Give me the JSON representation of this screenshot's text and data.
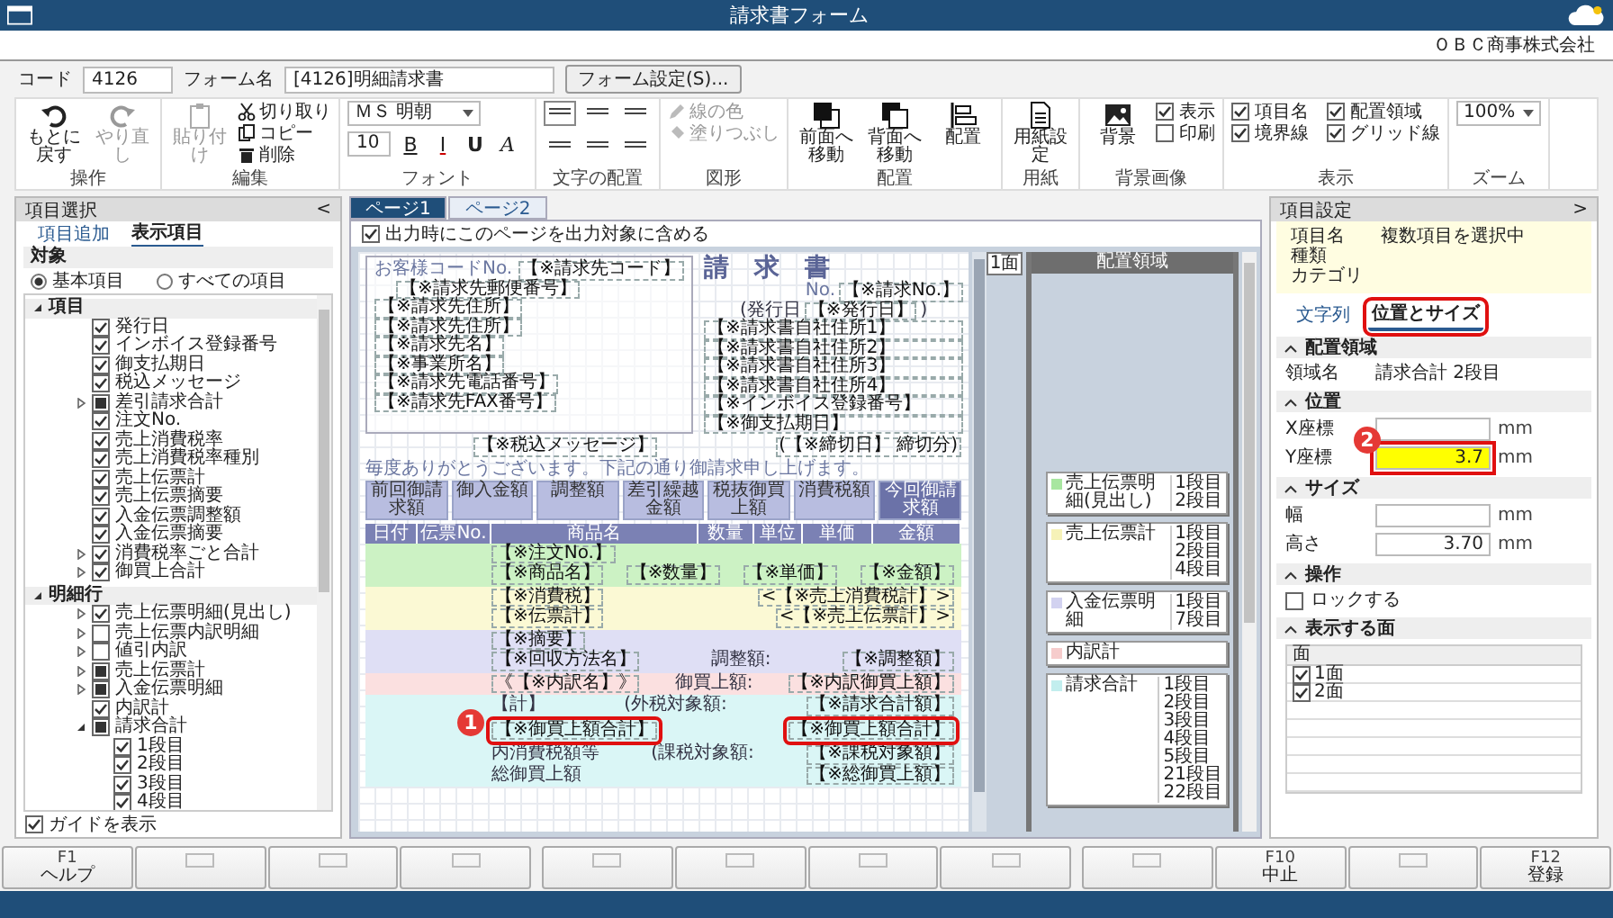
{
  "window": {
    "title": "請求書フォーム",
    "company": "ＯＢＣ商事株式会社"
  },
  "form_header": {
    "code_label": "コード",
    "code": "4126",
    "name_label": "フォーム名",
    "name": "[4126]明細請求書",
    "settings_button": "フォーム設定(S)..."
  },
  "ribbon": [
    {
      "name": "操作",
      "tools": [
        {
          "kind": "undo",
          "label": "もとに戻す",
          "disabled": false
        },
        {
          "kind": "redo",
          "label": "やり直し",
          "disabled": true
        }
      ]
    },
    {
      "name": "編集",
      "tools": [
        {
          "kind": "paste",
          "label": "貼り付け",
          "disabled": true
        },
        {
          "kind": "cut",
          "label": "切り取り",
          "disabled": false
        },
        {
          "kind": "copy",
          "label": "コピー",
          "disabled": false
        },
        {
          "kind": "delete",
          "label": "削除",
          "disabled": false
        }
      ]
    },
    {
      "name": "フォント",
      "tools": [
        {
          "kind": "select",
          "value": "ＭＳ 明朝"
        },
        {
          "kind": "field",
          "value": "10"
        },
        {
          "kind": "format",
          "label": "B"
        },
        {
          "kind": "format",
          "label": "I"
        },
        {
          "kind": "format",
          "label": "U"
        },
        {
          "kind": "format",
          "label": "A"
        }
      ]
    },
    {
      "name": "文字の配置",
      "tools": [
        {
          "kind": "align",
          "selected": true
        },
        {
          "kind": "align",
          "selected": false
        },
        {
          "kind": "align",
          "selected": false
        },
        {
          "kind": "align",
          "selected": false
        },
        {
          "kind": "align",
          "selected": false
        },
        {
          "kind": "align",
          "selected": false
        }
      ]
    },
    {
      "name": "図形",
      "tools": [
        {
          "kind": "line-color",
          "label": "線の色",
          "disabled": true
        },
        {
          "kind": "fill",
          "label": "塗りつぶし",
          "disabled": true
        }
      ]
    },
    {
      "name": "配置",
      "tools": [
        {
          "kind": "front",
          "label": "前面へ移動",
          "disabled": false
        },
        {
          "kind": "back",
          "label": "背面へ移動",
          "disabled": false
        },
        {
          "kind": "arrange",
          "label": "配置",
          "disabled": false
        }
      ]
    },
    {
      "name": "用紙",
      "tools": [
        {
          "kind": "paper",
          "label": "用紙設定",
          "disabled": false
        }
      ]
    },
    {
      "name": "背景画像",
      "tools": [
        {
          "kind": "image",
          "label": "背景",
          "disabled": false
        },
        {
          "kind": "check",
          "label": "表示",
          "checked": true
        },
        {
          "kind": "check",
          "label": "印刷",
          "checked": false
        }
      ]
    },
    {
      "name": "表示",
      "tools": [
        {
          "kind": "check",
          "label": "項目名",
          "checked": true
        },
        {
          "kind": "check",
          "label": "配置領域",
          "checked": true
        },
        {
          "kind": "check",
          "label": "境界線",
          "checked": true
        },
        {
          "kind": "check",
          "label": "グリッド線",
          "checked": true
        }
      ]
    },
    {
      "name": "ズーム",
      "tools": [
        {
          "kind": "select",
          "value": "100%"
        }
      ]
    }
  ],
  "item_panel": {
    "title": "項目選択",
    "collapse": "<",
    "tabs": [
      {
        "label": "項目追加",
        "selected": false
      },
      {
        "label": "表示項目",
        "selected": true
      }
    ],
    "section": "対象",
    "scope": [
      {
        "label": "基本項目",
        "selected": true
      },
      {
        "label": "すべての項目",
        "selected": false
      }
    ],
    "tree": [
      {
        "label": "項目",
        "expanded": true,
        "children": [
          {
            "label": "発行日",
            "checked": true
          },
          {
            "label": "インボイス登録番号",
            "checked": true
          },
          {
            "label": "御支払期日",
            "checked": true
          },
          {
            "label": "税込メッセージ",
            "checked": true
          },
          {
            "label": "差引請求合計",
            "checked": false,
            "mixed": true,
            "expanded": false
          },
          {
            "label": "注文No.",
            "checked": true
          },
          {
            "label": "売上消費税率",
            "checked": true
          },
          {
            "label": "売上消費税率種別",
            "checked": true
          },
          {
            "label": "売上伝票計",
            "checked": true
          },
          {
            "label": "売上伝票摘要",
            "checked": true
          },
          {
            "label": "入金伝票調整額",
            "checked": true
          },
          {
            "label": "入金伝票摘要",
            "checked": true
          },
          {
            "label": "消費税率ごと合計",
            "checked": true,
            "expanded": false
          },
          {
            "label": "御買上合計",
            "checked": true,
            "expanded": false
          }
        ]
      },
      {
        "label": "明細行",
        "expanded": true,
        "children": [
          {
            "label": "売上伝票明細(見出し)",
            "checked": true,
            "expanded": false
          },
          {
            "label": "売上伝票内訳明細",
            "checked": false,
            "expanded": false
          },
          {
            "label": "値引内訳",
            "checked": false,
            "expanded": false
          },
          {
            "label": "売上伝票計",
            "checked": false,
            "mixed": true,
            "expanded": false
          },
          {
            "label": "入金伝票明細",
            "checked": false,
            "mixed": true,
            "expanded": false
          },
          {
            "label": "内訳計",
            "checked": true
          },
          {
            "label": "請求合計",
            "checked": false,
            "mixed": true,
            "expanded": true,
            "children": [
              {
                "label": "1段目",
                "checked": true
              },
              {
                "label": "2段目",
                "checked": true
              },
              {
                "label": "3段目",
                "checked": true
              },
              {
                "label": "4段目",
                "checked": true
              }
            ]
          }
        ]
      }
    ],
    "guide": {
      "label": "ガイドを表示",
      "checked": true
    }
  },
  "canvas": {
    "tabs": [
      {
        "label": "ページ1",
        "selected": true
      },
      {
        "label": "ページ2",
        "selected": false
      }
    ],
    "include_option": {
      "label": "出力時にこのページを出力対象に含める",
      "checked": true
    },
    "document": {
      "customer": {
        "code_label": "お客様コードNo.",
        "fields": [
          "【※請求先コード】",
          "【※請求先郵便番号】",
          "【※請求先住所】",
          "【※請求先住所】",
          "【※請求先名】",
          "【※事業所名】",
          "【※請求先電話番号】",
          "【※請求先FAX番号】"
        ]
      },
      "title": "請　求　書",
      "no_label": "No.",
      "no": "【※請求No.】",
      "issue_label": "(発行日",
      "issue": "【※発行日】",
      "issue_close": ")",
      "company_fields": [
        "【※請求書自社住所1】",
        "【※請求書自社住所2】",
        "【※請求書自社住所3】",
        "【※請求書自社住所4】",
        "【※インボイス登録番号】",
        "【※御支払期日】"
      ],
      "message": "【※税込メッセージ】",
      "thanks": "毎度ありがとうございます。下記の通り御請求申し上げます。",
      "closing": "(【※締切日】 締切分)",
      "summary": [
        "前回御請求額",
        "御入金額",
        "調整額",
        "差引繰越金額",
        "税抜御買上額",
        "消費税額",
        "今回御請求額"
      ],
      "columns": [
        "日付",
        "伝票No.",
        "商品名",
        "数量",
        "単位",
        "単価",
        "金額"
      ],
      "bands": [
        {
          "color": "#ccf2c4",
          "lines": [
            [
              {
                "text": "【※注文No.】",
                "kind": "field"
              }
            ],
            [
              {
                "text": "【※商品名】",
                "kind": "field"
              },
              {
                "text": "【※数量】",
                "kind": "field"
              },
              {
                "text": "【※単価】",
                "kind": "field"
              },
              {
                "text": "【※金額】",
                "kind": "field"
              }
            ]
          ]
        },
        {
          "color": "#fbf9d4",
          "lines": [
            [
              {
                "text": "【※消費税】",
                "kind": "field"
              },
              {
                "text": "<【※売上消費税計】>",
                "kind": "field"
              }
            ],
            [
              {
                "text": "【※伝票計】",
                "kind": "field"
              },
              {
                "text": "<【※売上伝票計】>",
                "kind": "field"
              }
            ]
          ]
        },
        {
          "color": "#dfdff5",
          "lines": [
            [
              {
                "text": "【※摘要】",
                "kind": "field"
              }
            ],
            [
              {
                "text": "【※回収方法名】",
                "kind": "field"
              },
              {
                "text": "調整額:",
                "kind": "label"
              },
              {
                "text": "【※調整額】",
                "kind": "field"
              }
            ]
          ]
        },
        {
          "color": "#fbe0e0",
          "lines": [
            [
              {
                "text": "《【※内訳名】》",
                "kind": "field"
              },
              {
                "text": "御買上額:",
                "kind": "label"
              },
              {
                "text": "【※内訳御買上額】",
                "kind": "field"
              }
            ]
          ]
        },
        {
          "color": "#daf6f6",
          "lines": [
            [
              {
                "text": "【計】",
                "kind": "label"
              },
              {
                "text": "(外税対象額:",
                "kind": "label"
              },
              {
                "text": "【※請求合計額】",
                "kind": "field"
              }
            ],
            [
              {
                "text": "【※御買上額合計】",
                "kind": "selected-field",
                "badge": "1"
              },
              {
                "text": "【※御買上額合計】",
                "kind": "selected-field"
              }
            ],
            [
              {
                "text": "内消費税額等",
                "kind": "label"
              },
              {
                "text": "(課税対象額:",
                "kind": "label"
              },
              {
                "text": "【※課税対象額】",
                "kind": "field"
              }
            ],
            [
              {
                "text": "総御買上額",
                "kind": "label"
              },
              {
                "text": "【※総御買上額】",
                "kind": "field"
              }
            ]
          ]
        }
      ]
    },
    "face_label": "1面",
    "areas_title": "配置領域",
    "areas": [
      {
        "name": "売上伝票明細(見出し)",
        "color": "#a8e6a0",
        "rows": [
          "1段目",
          "2段目"
        ]
      },
      {
        "name": "売上伝票計",
        "color": "#f6f2b8",
        "rows": [
          "1段目",
          "2段目",
          "4段目"
        ]
      },
      {
        "name": "入金伝票明細",
        "color": "#d2d2f0",
        "rows": [
          "1段目",
          "7段目"
        ]
      },
      {
        "name": "内訳計",
        "color": "#f6cccc"
      },
      {
        "name": "請求合計",
        "color": "#c2eeee",
        "rows": [
          "1段目",
          "2段目",
          "3段目",
          "4段目",
          "5段目",
          "21段目",
          "22段目"
        ]
      }
    ]
  },
  "properties": {
    "title": "項目設定",
    "collapse": ">",
    "info": [
      {
        "label": "項目名",
        "value": "複数項目を選択中"
      },
      {
        "label": "種類"
      },
      {
        "label": "カテゴリ"
      }
    ],
    "tabs": [
      {
        "label": "文字列",
        "selected": false,
        "highlighted": false
      },
      {
        "label": "位置とサイズ",
        "selected": true,
        "highlighted": true
      }
    ],
    "sections": [
      {
        "title": "配置領域",
        "kind": "info",
        "rows": [
          {
            "label": "領域名",
            "value": "請求合計 2段目"
          }
        ]
      },
      {
        "title": "位置",
        "kind": "fields",
        "rows": [
          {
            "label": "X座標",
            "unit": "mm",
            "highlighted": false
          },
          {
            "label": "Y座標",
            "value": "3.7",
            "unit": "mm",
            "highlighted": true,
            "badge": "2"
          }
        ]
      },
      {
        "title": "サイズ",
        "kind": "fields",
        "rows": [
          {
            "label": "幅",
            "unit": "mm",
            "highlighted": false
          },
          {
            "label": "高さ",
            "value": "3.70",
            "unit": "mm",
            "highlighted": false
          }
        ]
      },
      {
        "title": "操作",
        "kind": "checks",
        "rows": [
          {
            "label": "ロックする",
            "checked": false
          }
        ]
      },
      {
        "title": "表示する面",
        "kind": "table",
        "header": "面",
        "rows": [
          {
            "label": "1面",
            "checked": true
          },
          {
            "label": "2面",
            "checked": true
          }
        ]
      }
    ]
  },
  "function_keys": [
    {
      "kind": "command",
      "key": "F1",
      "label": "ヘルプ"
    },
    {
      "kind": "empty"
    },
    {
      "kind": "empty"
    },
    {
      "kind": "empty"
    },
    {
      "kind": "empty"
    },
    {
      "kind": "empty"
    },
    {
      "kind": "empty"
    },
    {
      "kind": "empty"
    },
    {
      "kind": "empty"
    },
    {
      "kind": "command",
      "key": "F10",
      "label": "中止"
    },
    {
      "kind": "empty"
    },
    {
      "kind": "command",
      "key": "F12",
      "label": "登録"
    }
  ]
}
